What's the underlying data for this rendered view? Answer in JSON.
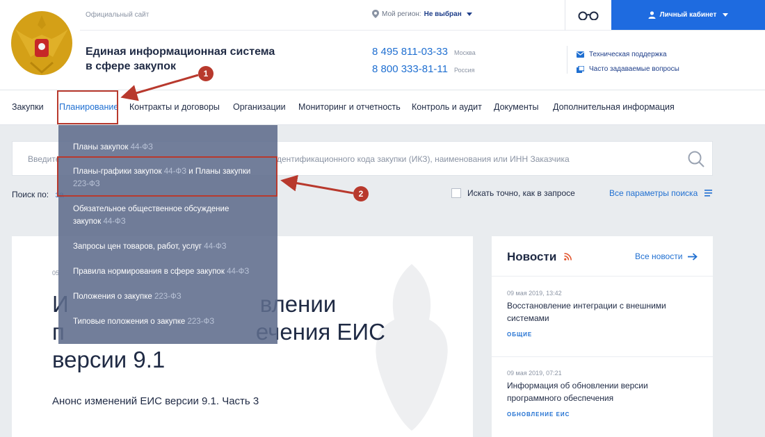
{
  "header": {
    "official": "Официальный сайт",
    "region_label": "Мой регион:",
    "region_value": "Не выбран",
    "cabinet": "Личный кабинет",
    "title_line1": "Единая информационная система",
    "title_line2": "в сфере закупок",
    "phones": [
      {
        "number": "8 495 811-03-33",
        "city": "Москва"
      },
      {
        "number": "8 800 333-81-11",
        "city": "Россия"
      }
    ],
    "support": [
      {
        "label": "Техническая поддержка",
        "icon": "mail-icon"
      },
      {
        "label": "Часто задаваемые вопросы",
        "icon": "faq-icon"
      }
    ]
  },
  "nav": {
    "items": [
      "Закупки",
      "Планирование",
      "Контракты и договоры",
      "Организации",
      "Мониторинг и отчетность",
      "Контроль и аудит",
      "Документы",
      "Дополнительная информация"
    ],
    "active": "Планирование"
  },
  "search": {
    "placeholder_start": "Введите",
    "placeholder_end": "дентификационного кода закупки (ИКЗ), наименования или ИНН Заказчика",
    "search_by_label": "Поиск по:",
    "search_by_value": "за",
    "exact_label": "Искать точно, как в запросе",
    "all_params": "Все параметры поиска"
  },
  "dropdown": {
    "items": [
      {
        "l1": "Планы закупок ",
        "law1": "44-ФЗ",
        "l2": "",
        "law2": ""
      },
      {
        "l1": "Планы-графики закупок ",
        "law1": "44-ФЗ",
        "l1b": " и Планы закупки",
        "l2": "",
        "law2": "223-ФЗ"
      },
      {
        "l1": "Обязательное общественное обсуждение",
        "law1": "",
        "l2": "закупок ",
        "law2": "44-ФЗ"
      },
      {
        "l1": "Запросы цен товаров, работ, услуг ",
        "law1": "44-ФЗ",
        "l2": "",
        "law2": ""
      },
      {
        "l1": "Правила нормирования в сфере закупок ",
        "law1": "44-ФЗ",
        "l2": "",
        "law2": ""
      },
      {
        "l1": "Положения о закупке ",
        "law1": "223-ФЗ",
        "l2": "",
        "law2": ""
      },
      {
        "l1": "Типовые положения о закупке ",
        "law1": "223-ФЗ",
        "l2": "",
        "law2": ""
      }
    ]
  },
  "main": {
    "date": "05",
    "title_line1": "И                              влении",
    "title_line2": "п                              ечения ЕИС",
    "title_line3": "версии 9.1",
    "subtitle": "Анонс изменений ЕИС версии 9.1. Часть 3"
  },
  "news": {
    "title": "Новости",
    "all": "Все новости",
    "items": [
      {
        "date": "09 мая 2019, 13:42",
        "text": "Восстановление интеграции с внешними системами",
        "tag": "ОБЩИЕ"
      },
      {
        "date": "09 мая 2019, 07:21",
        "text": "Информация об обновлении версии программного обеспечения",
        "tag": "ОБНОВЛЕНИЕ ЕИС"
      }
    ]
  },
  "callouts": {
    "one": "1",
    "two": "2"
  },
  "colors": {
    "accent": "#1f6fd1",
    "cabinet_bg": "#1e6be0",
    "callout": "#b8392d",
    "dropdown_bg": "#5e6c8c"
  }
}
